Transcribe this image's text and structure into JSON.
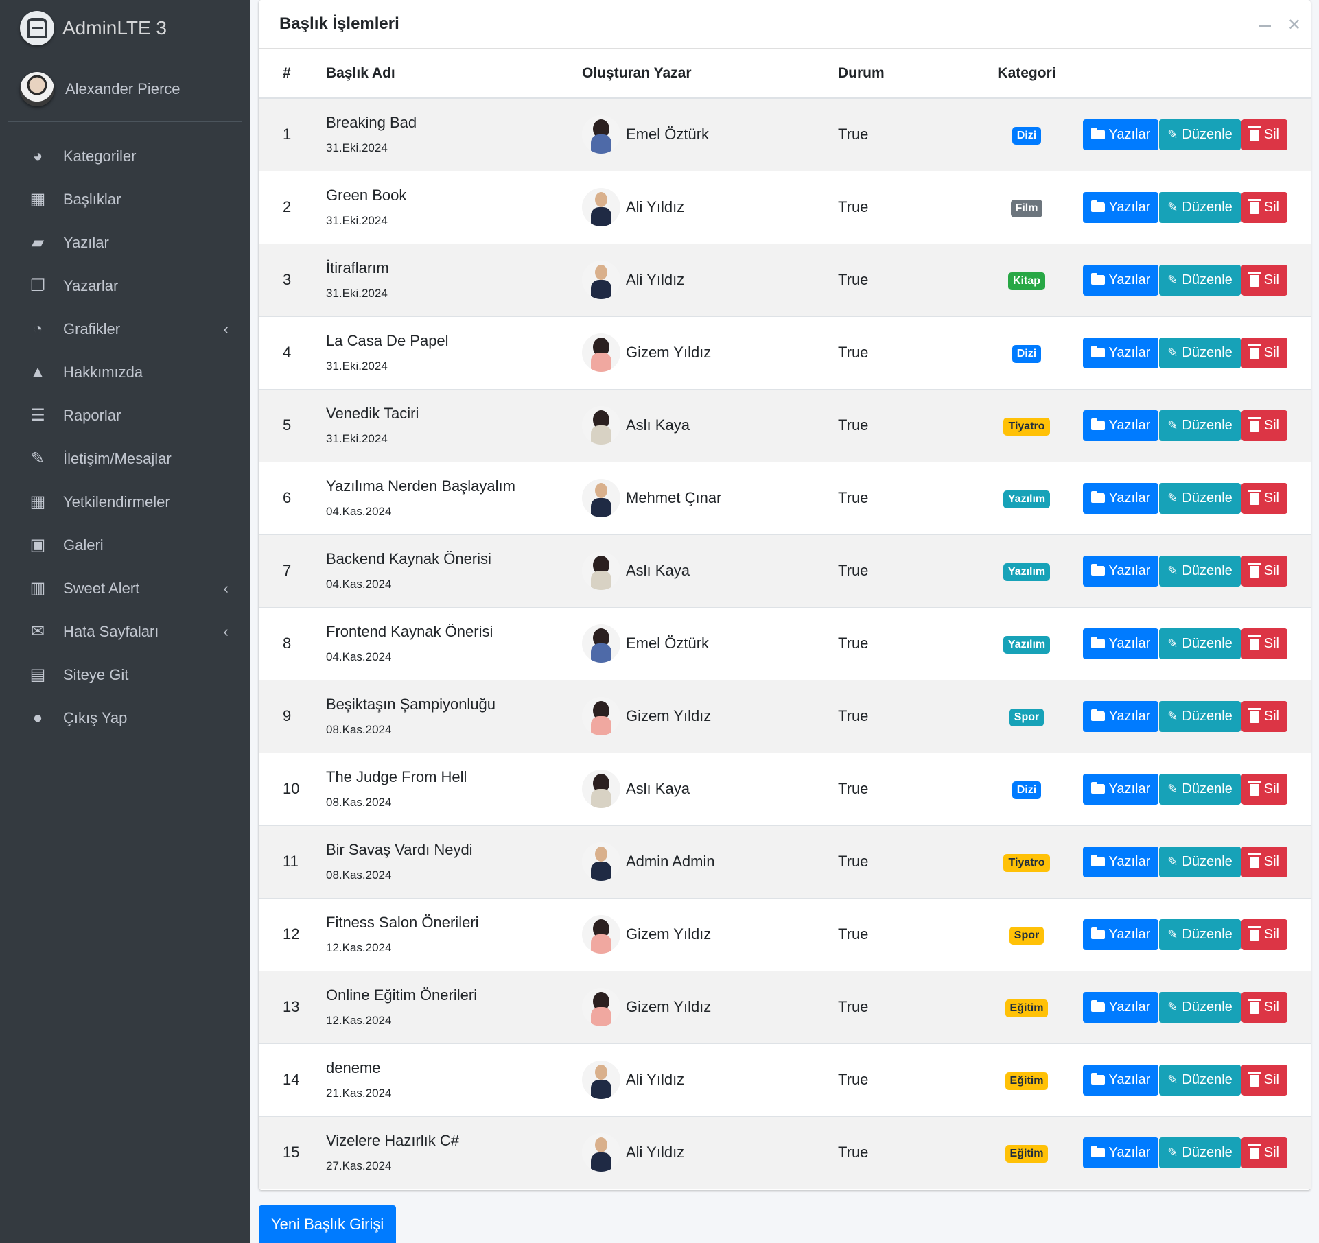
{
  "brand": "AdminLTE 3",
  "user": "Alexander Pierce",
  "nav": [
    {
      "label": "Kategoriler",
      "icon": "tachometer-icon",
      "glyph": "◕",
      "caret": false
    },
    {
      "label": "Başlıklar",
      "icon": "grid-icon",
      "glyph": "▦",
      "caret": false
    },
    {
      "label": "Yazılar",
      "icon": "book-reader-icon",
      "glyph": "▰",
      "caret": false
    },
    {
      "label": "Yazarlar",
      "icon": "copy-icon",
      "glyph": "❐",
      "caret": false
    },
    {
      "label": "Grafikler",
      "icon": "chart-pie-icon",
      "glyph": "◔",
      "caret": true
    },
    {
      "label": "Hakkımızda",
      "icon": "tree-icon",
      "glyph": "▲",
      "caret": false
    },
    {
      "label": "Raporlar",
      "icon": "bars-icon",
      "glyph": "☰",
      "caret": false
    },
    {
      "label": "İletişim/Mesajlar",
      "icon": "edit-icon",
      "glyph": "✎",
      "caret": false
    },
    {
      "label": "Yetkilendirmeler",
      "icon": "calendar-icon",
      "glyph": "▦",
      "caret": false
    },
    {
      "label": "Galeri",
      "icon": "image-icon",
      "glyph": "▣",
      "caret": false
    },
    {
      "label": "Sweet Alert",
      "icon": "map-icon",
      "glyph": "▥",
      "caret": true
    },
    {
      "label": "Hata Sayfaları",
      "icon": "envelope-icon",
      "glyph": "✉",
      "caret": true
    },
    {
      "label": "Siteye Git",
      "icon": "newspaper-icon",
      "glyph": "▤",
      "caret": false
    },
    {
      "label": "Çıkış Yap",
      "icon": "apple-icon",
      "glyph": "●",
      "caret": false
    }
  ],
  "card": {
    "title": "Başlık İşlemleri",
    "columns": {
      "num": "#",
      "title": "Başlık Adı",
      "author": "Oluşturan Yazar",
      "status": "Durum",
      "category": "Kategori"
    },
    "buttons": {
      "posts": "Yazılar",
      "edit": "Düzenle",
      "delete": "Sil"
    }
  },
  "rows": [
    {
      "num": "1",
      "title": "Breaking Bad",
      "date": "31.Eki.2024",
      "author": "Emel Öztürk",
      "avatar": "female-blue",
      "status": "True",
      "category": "Dizi",
      "badge": "primary"
    },
    {
      "num": "2",
      "title": "Green Book",
      "date": "31.Eki.2024",
      "author": "Ali Yıldız",
      "avatar": "male-dark",
      "status": "True",
      "category": "Film",
      "badge": "secondary"
    },
    {
      "num": "3",
      "title": "İtiraflarım",
      "date": "31.Eki.2024",
      "author": "Ali Yıldız",
      "avatar": "male-dark",
      "status": "True",
      "category": "Kitap",
      "badge": "success"
    },
    {
      "num": "4",
      "title": "La Casa De Papel",
      "date": "31.Eki.2024",
      "author": "Gizem Yıldız",
      "avatar": "female-pink",
      "status": "True",
      "category": "Dizi",
      "badge": "primary"
    },
    {
      "num": "5",
      "title": "Venedik Taciri",
      "date": "31.Eki.2024",
      "author": "Aslı Kaya",
      "avatar": "female-light",
      "status": "True",
      "category": "Tiyatro",
      "badge": "warning"
    },
    {
      "num": "6",
      "title": "Yazılıma Nerden Başlayalım",
      "date": "04.Kas.2024",
      "author": "Mehmet Çınar",
      "avatar": "male-dark",
      "status": "True",
      "category": "Yazılım",
      "badge": "info"
    },
    {
      "num": "7",
      "title": "Backend Kaynak Önerisi",
      "date": "04.Kas.2024",
      "author": "Aslı Kaya",
      "avatar": "female-light",
      "status": "True",
      "category": "Yazılım",
      "badge": "info"
    },
    {
      "num": "8",
      "title": "Frontend Kaynak Önerisi",
      "date": "04.Kas.2024",
      "author": "Emel Öztürk",
      "avatar": "female-blue",
      "status": "True",
      "category": "Yazılım",
      "badge": "info"
    },
    {
      "num": "9",
      "title": "Beşiktaşın Şampiyonluğu",
      "date": "08.Kas.2024",
      "author": "Gizem Yıldız",
      "avatar": "female-pink",
      "status": "True",
      "category": "Spor",
      "badge": "info"
    },
    {
      "num": "10",
      "title": "The Judge From Hell",
      "date": "08.Kas.2024",
      "author": "Aslı Kaya",
      "avatar": "female-light",
      "status": "True",
      "category": "Dizi",
      "badge": "primary"
    },
    {
      "num": "11",
      "title": "Bir Savaş Vardı Neydi",
      "date": "08.Kas.2024",
      "author": "Admin Admin",
      "avatar": "male-dark",
      "status": "True",
      "category": "Tiyatro",
      "badge": "warning"
    },
    {
      "num": "12",
      "title": "Fitness Salon Önerileri",
      "date": "12.Kas.2024",
      "author": "Gizem Yıldız",
      "avatar": "female-pink",
      "status": "True",
      "category": "Spor",
      "badge": "warning"
    },
    {
      "num": "13",
      "title": "Online Eğitim Önerileri",
      "date": "12.Kas.2024",
      "author": "Gizem Yıldız",
      "avatar": "female-pink",
      "status": "True",
      "category": "Eğitim",
      "badge": "warning"
    },
    {
      "num": "14",
      "title": "deneme",
      "date": "21.Kas.2024",
      "author": "Ali Yıldız",
      "avatar": "male-dark",
      "status": "True",
      "category": "Eğitim",
      "badge": "warning"
    },
    {
      "num": "15",
      "title": "Vizelere Hazırlık C#",
      "date": "27.Kas.2024",
      "author": "Ali Yıldız",
      "avatar": "male-dark",
      "status": "True",
      "category": "Eğitim",
      "badge": "warning"
    }
  ],
  "new_button": "Yeni Başlık Girişi"
}
